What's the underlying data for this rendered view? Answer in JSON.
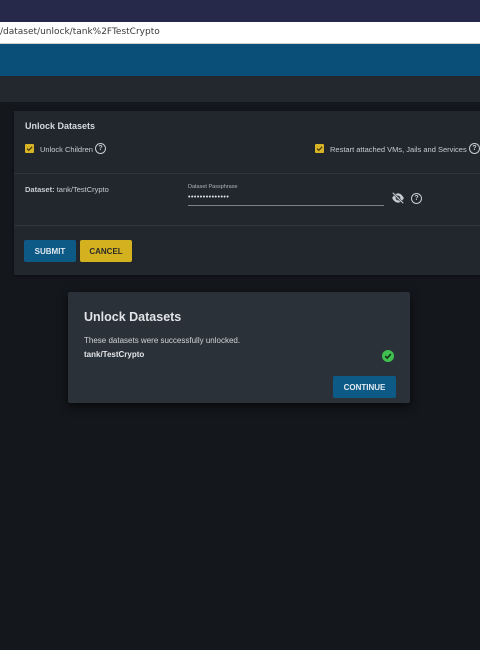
{
  "browser": {
    "url": "/dataset/unlock/tank%2FTestCrypto"
  },
  "unlock_card": {
    "title": "Unlock Datasets",
    "unlock_children": {
      "label": "Unlock Children",
      "checked": true
    },
    "restart_services": {
      "label": "Restart attached VMs, Jails and Services",
      "checked": true
    },
    "dataset_prefix": "Dataset:",
    "dataset_name": "tank/TestCrypto",
    "passphrase": {
      "label": "Dataset Passphrase",
      "value": "••••••••••••••"
    },
    "submit_label": "SUBMIT",
    "cancel_label": "CANCEL"
  },
  "dialog": {
    "title": "Unlock Datasets",
    "message": "These datasets were successfully unlocked.",
    "dataset": "tank/TestCrypto",
    "status_icon": "success-check-icon",
    "continue_label": "CONTINUE"
  },
  "colors": {
    "accent_blue": "#0d5a86",
    "accent_yellow": "#d4b21f",
    "success_green": "#3fbf4f"
  }
}
